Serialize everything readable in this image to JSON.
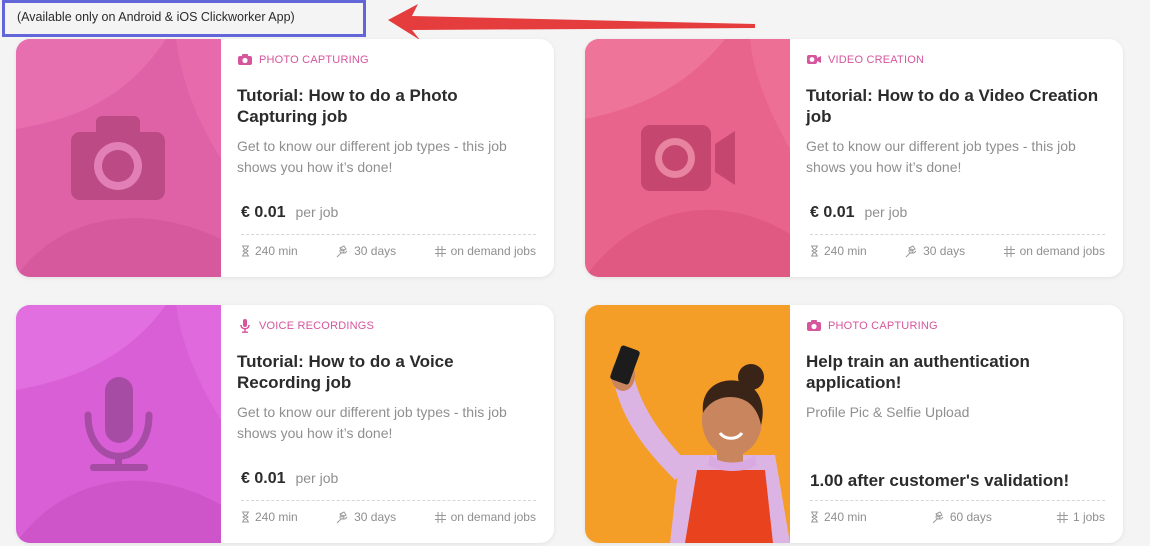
{
  "note": "(Available only on Android & iOS Clickworker App)",
  "colors": {
    "accent": "#d6559c",
    "note_border": "#6366d8",
    "arrow": "#e53d3d"
  },
  "cards": [
    {
      "category": "PHOTO CAPTURING",
      "category_icon": "camera-icon",
      "title": "Tutorial: How to do a Photo Capturing job",
      "description": "Get to know our different job types - this job shows you how it’s done!",
      "price": "€ 0.01",
      "per": "per job",
      "duration": "240 min",
      "days": "30 days",
      "jobs": "on demand jobs",
      "thumb_icon": "camera-icon"
    },
    {
      "category": "VIDEO CREATION",
      "category_icon": "video-camera-icon",
      "title": "Tutorial: How to do a Video Creation job",
      "description": "Get to know our different job types - this job shows you how it’s done!",
      "price": "€ 0.01",
      "per": "per job",
      "duration": "240 min",
      "days": "30 days",
      "jobs": "on demand jobs",
      "thumb_icon": "video-camera-icon"
    },
    {
      "category": "VOICE RECORDINGS",
      "category_icon": "microphone-icon",
      "title": "Tutorial: How to do a Voice Recording job",
      "description": "Get to know our different job types - this job shows you how it’s done!",
      "price": "€ 0.01",
      "per": "per job",
      "duration": "240 min",
      "days": "30 days",
      "jobs": "on demand jobs",
      "thumb_icon": "microphone-icon"
    },
    {
      "category": "PHOTO CAPTURING",
      "category_icon": "camera-icon",
      "title": "Help train an authentication application!",
      "description": "Profile Pic & Selfie Upload",
      "bonus": "1.00 after customer's validation!",
      "duration": "240 min",
      "days": "60 days",
      "jobs": "1 jobs",
      "thumb_icon": "selfie-photo"
    }
  ]
}
